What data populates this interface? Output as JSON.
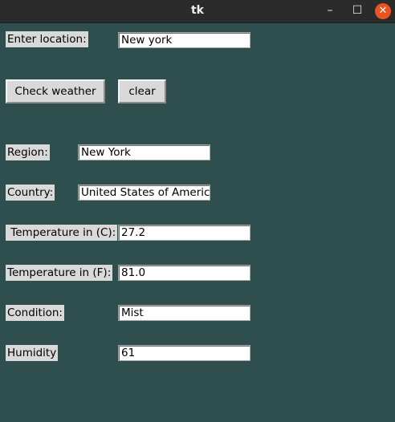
{
  "window": {
    "title": "tk",
    "minimize_glyph": "–",
    "maximize_glyph": "☐",
    "close_glyph": "✕"
  },
  "form": {
    "location_label": "Enter location:",
    "location_value": "New york",
    "check_button": "Check weather",
    "clear_button": "clear"
  },
  "results": {
    "region_label": "Region:",
    "region_value": "New York",
    "country_label": "Country:",
    "country_value": "United States of America",
    "temp_c_label": " Temperature in (C):",
    "temp_c_value": "27.2",
    "temp_f_label": "Temperature in (F):",
    "temp_f_value": "81.0",
    "condition_label": "Condition:",
    "condition_value": "Mist",
    "humidity_label": "Humidity",
    "humidity_value": "61"
  },
  "colors": {
    "background": "#2f4f4f",
    "close_button": "#e95420"
  }
}
